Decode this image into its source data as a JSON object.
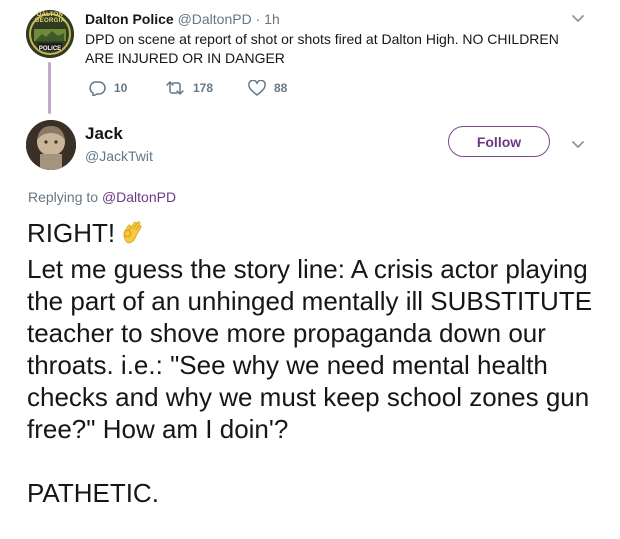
{
  "parent_tweet": {
    "display_name": "Dalton Police",
    "handle": "@DaltonPD",
    "separator": "·",
    "time": "1h",
    "avatar_text_top": "DALTON GEORGIA",
    "avatar_text_bottom": "POLICE",
    "text": "DPD on scene at report of shot or shots fired at Dalton High. NO CHILDREN ARE INJURED OR IN DANGER",
    "replies": "10",
    "retweets": "178",
    "likes": "88"
  },
  "main_tweet": {
    "display_name": "Jack",
    "handle": "@JackTwit",
    "follow_label": "Follow",
    "replying_prefix": "Replying to",
    "replying_to": "@DaltonPD",
    "line1": "RIGHT!",
    "line1_emoji": "ok-hand-icon",
    "paragraph": "Let me guess the story line: A crisis actor playing the part of an unhinged mentally ill SUBSTITUTE teacher to shove more propaganda down our throats. i.e.:  \"See why we need mental health checks and why we must keep school zones  gun free?\" How am I doin'?",
    "closing": "PATHETIC."
  },
  "colors": {
    "text": "#14171a",
    "muted": "#657786",
    "accent": "#6b3a82",
    "thread_line": "#c3aacb"
  }
}
